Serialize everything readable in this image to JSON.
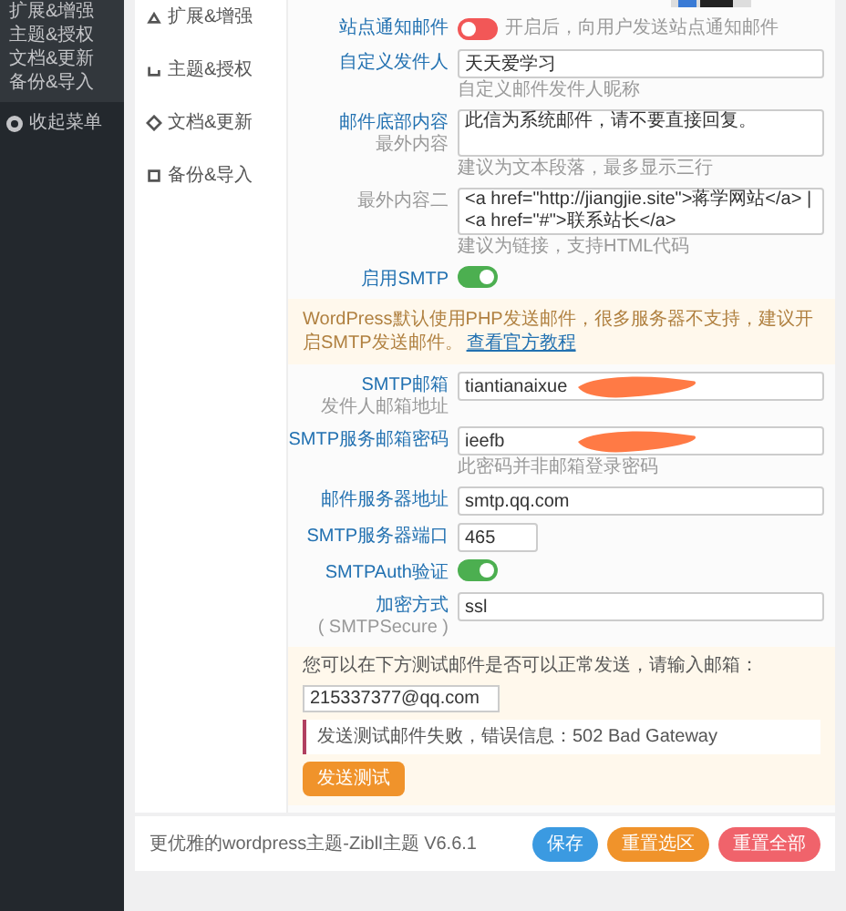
{
  "admin_menu": {
    "items": [
      {
        "label": "扩展&增强"
      },
      {
        "label": "主题&授权"
      },
      {
        "label": "文档&更新"
      },
      {
        "label": "备份&导入"
      }
    ],
    "collapse": "收起菜单"
  },
  "settings_nav": [
    {
      "label": "扩展&增强"
    },
    {
      "label": "主题&授权"
    },
    {
      "label": "文档&更新"
    },
    {
      "label": "备份&导入"
    }
  ],
  "fields": [
    {
      "kind": "toggle",
      "label": "站点通知邮件",
      "on": false,
      "description": "开启后，向用户发送站点通知邮件"
    },
    {
      "kind": "input",
      "label": "自定义发件人",
      "value": "天天爱学习",
      "hint": "自定义邮件发件人昵称"
    },
    {
      "kind": "textarea",
      "label": "邮件底部内容",
      "sublabel": "最外内容",
      "value": "此信为系统邮件，请不要直接回复。",
      "hint": "建议为文本段落，最多显示三行"
    },
    {
      "kind": "textarea",
      "label": "最外内容二",
      "secondary": true,
      "value": "<a href=\"http://jiangjie.site\">蒋学网站</a> |\n<a href=\"#\">联系站长</a>",
      "hint": "建议为链接，支持HTML代码"
    },
    {
      "kind": "toggle",
      "label": "启用SMTP",
      "on": true
    },
    {
      "kind": "notice",
      "text": "WordPress默认使用PHP发送邮件，很多服务器不支持，建议开启SMTP发送邮件。",
      "link": "查看官方教程"
    },
    {
      "kind": "input",
      "label": "SMTP邮箱",
      "sublabel": "发件人邮箱地址",
      "value": "tiantianaixue",
      "redacted": true
    },
    {
      "kind": "input",
      "label": "SMTP服务邮箱密码",
      "value": "ieefb",
      "redacted": true,
      "hint": "此密码并非邮箱登录密码"
    },
    {
      "kind": "input",
      "label": "邮件服务器地址",
      "value": "smtp.qq.com"
    },
    {
      "kind": "input",
      "label": "SMTP服务器端口",
      "value": "465",
      "short": true
    },
    {
      "kind": "toggle",
      "label": "SMTPAuth验证",
      "on": true
    },
    {
      "kind": "input",
      "label": "加密方式",
      "sublabel": "( SMTPSecure )",
      "value": "ssl"
    }
  ],
  "test": {
    "prompt": "您可以在下方测试邮件是否可以正常发送，请输入邮箱：",
    "email": "215337377@qq.com",
    "error": "发送测试邮件失败，错误信息：502 Bad Gateway",
    "button": "发送测试"
  },
  "footer": {
    "credit": "更优雅的wordpress主题-Zibll主题 V6.6.1",
    "buttons": [
      {
        "label": "保存",
        "color": "#3b9ae1"
      },
      {
        "label": "重置选区",
        "color": "#f0932b"
      },
      {
        "label": "重置全部",
        "color": "#f0636b"
      }
    ]
  }
}
